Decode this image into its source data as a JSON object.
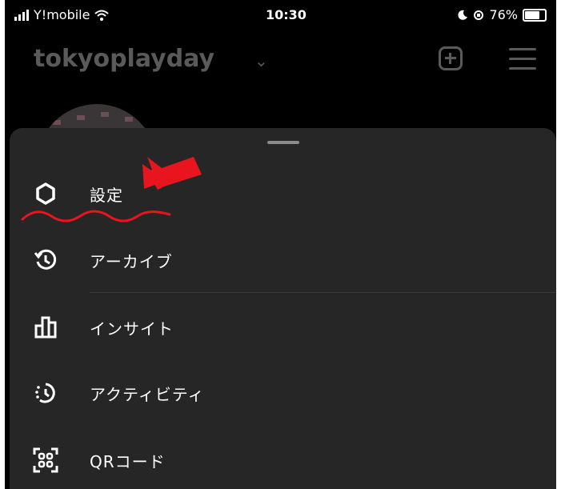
{
  "status_bar": {
    "carrier": "Y!mobile",
    "time": "10:30",
    "battery": "76%"
  },
  "profile": {
    "username": "tokyoplayday"
  },
  "menu": {
    "items": [
      {
        "label": "設定",
        "icon": "gear-icon"
      },
      {
        "label": "アーカイブ",
        "icon": "archive-history-icon"
      },
      {
        "label": "インサイト",
        "icon": "insights-bar-chart-icon"
      },
      {
        "label": "アクティビティ",
        "icon": "activity-icon"
      },
      {
        "label": "QRコード",
        "icon": "qr-code-icon"
      }
    ]
  },
  "colors": {
    "background": "#000000",
    "sheet": "#262626",
    "text": "#ffffff",
    "dimmed": "#5a5a5a",
    "annotation_red": "#e8141e"
  }
}
